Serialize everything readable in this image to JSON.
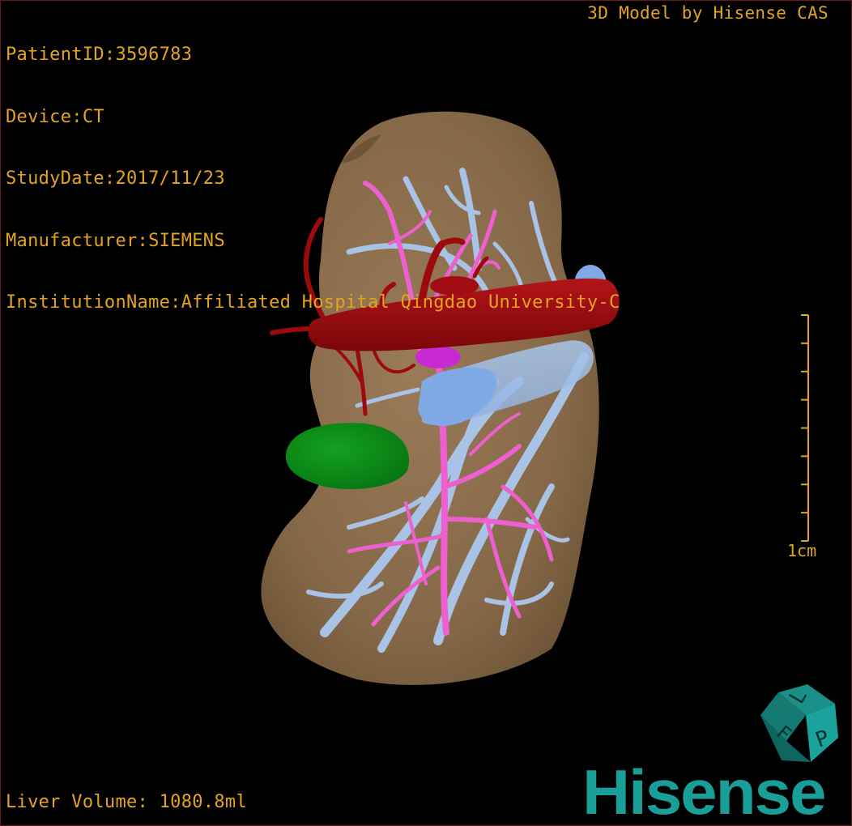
{
  "overlay": {
    "patient_id": "PatientID:3596783",
    "device": "Device:CT",
    "study_date": "StudyDate:2017/11/23",
    "manufacturer": "Manufacturer:SIEMENS",
    "institution": "InstitutionName:Affiliated Hospital Qingdao University-C",
    "model_credit": "3D Model by Hisense CAS",
    "liver_volume": "Liver Volume: 1080.8ml"
  },
  "scale_bar": {
    "label": "1cm",
    "tick_count": 9
  },
  "orientation_cube": {
    "face_top": "L",
    "face_right": "P",
    "face_left": "F"
  },
  "brand": {
    "name": "Hisense",
    "color": "#1a9e98"
  },
  "colors": {
    "overlay_text": "#e3a420",
    "liver": "#8b6e4f",
    "artery": "#9c0a0e",
    "portal_vein": "#ee5fd0",
    "hepatic_vein": "#a9c3e6",
    "gallbladder": "#0c8a17"
  },
  "structures": [
    {
      "name": "liver",
      "color": "#8b6e4f"
    },
    {
      "name": "hepatic-artery",
      "color": "#9c0a0e"
    },
    {
      "name": "portal-vein",
      "color": "#ee5fd0"
    },
    {
      "name": "hepatic-vein",
      "color": "#a9c3e6"
    },
    {
      "name": "gallbladder",
      "color": "#0c8a17"
    }
  ]
}
